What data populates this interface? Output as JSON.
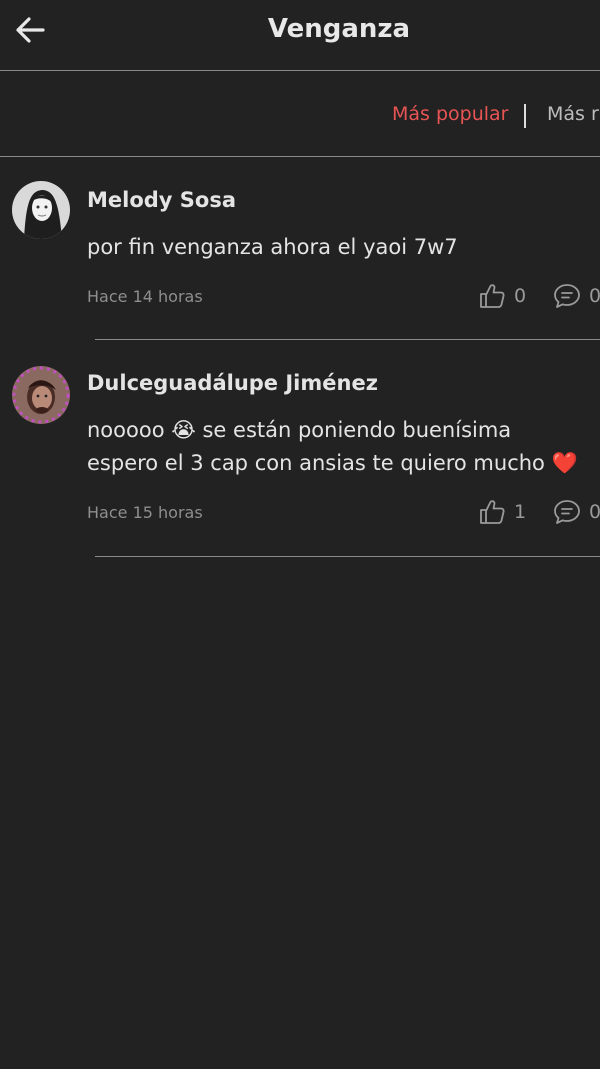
{
  "header": {
    "title": "Venganza",
    "back_icon": "arrow-left-icon"
  },
  "sort": {
    "popular_label": "Más popular",
    "recent_label": "Más r",
    "active_color": "#e85454"
  },
  "comments": [
    {
      "author": "Melody Sosa",
      "lines": [
        "por fin venganza ahora el yaoi 7w7"
      ],
      "time": "Hace 14 horas",
      "likes": "0",
      "replies": "0"
    },
    {
      "author": "Dulceguadálupe Jiménez",
      "line1_start": "nooooo",
      "line1_emoji": "😭",
      "line1_end": "se están poniendo buenísima",
      "line2_start": "espero el 3 cap con ansias te quiero mucho",
      "line2_emoji": "❤️",
      "time": "Hace 15 horas",
      "likes": "1",
      "replies": "0"
    }
  ]
}
